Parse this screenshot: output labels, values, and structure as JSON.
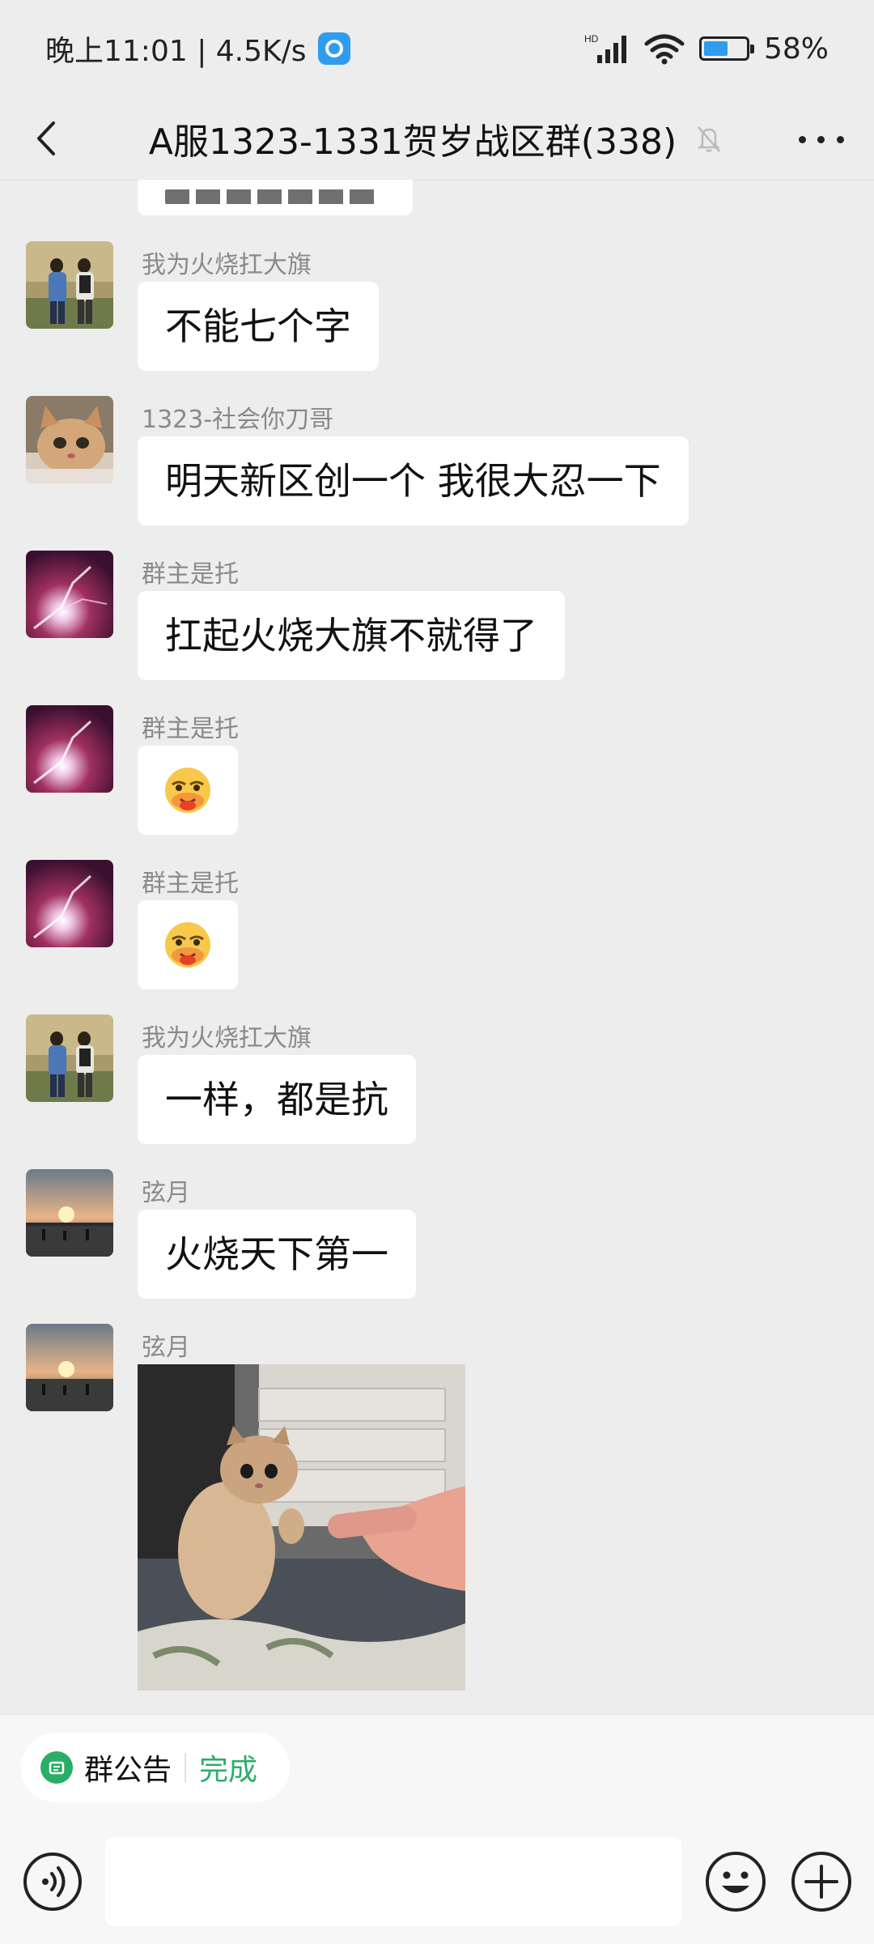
{
  "status_bar": {
    "time_speed": "晚上11:01 | 4.5K/s",
    "network_label": "HD",
    "battery": "58%",
    "battery_level": 0.58
  },
  "header": {
    "title": "A服1323-1331贺岁战区群(338)"
  },
  "messages": [
    {
      "sender": "我为火烧扛大旗",
      "text": "不能七个字",
      "avatar": "people-walking"
    },
    {
      "sender": "1323-社会你刀哥",
      "text": "明天新区创一个 我很大忍一下",
      "avatar": "cat"
    },
    {
      "sender": "群主是托",
      "text": "扛起火烧大旗不就得了",
      "avatar": "purple-flare"
    },
    {
      "sender": "群主是托",
      "emoji": "🥴",
      "avatar": "purple-flare"
    },
    {
      "sender": "群主是托",
      "emoji": "🥴",
      "avatar": "purple-flare"
    },
    {
      "sender": "我为火烧扛大旗",
      "text": "一样，都是抗",
      "avatar": "people-walking"
    },
    {
      "sender": "弦月",
      "text": "火烧天下第一",
      "avatar": "sunset"
    },
    {
      "sender": "弦月",
      "image": "kitten-and-finger",
      "avatar": "sunset"
    }
  ],
  "bottom": {
    "notice_label": "群公告",
    "done_label": "完成",
    "input_value": ""
  },
  "colors": {
    "background": "#ededed",
    "bubble": "#ffffff",
    "accent_green": "#2aae67",
    "sender_gray": "#8a8a8a"
  }
}
